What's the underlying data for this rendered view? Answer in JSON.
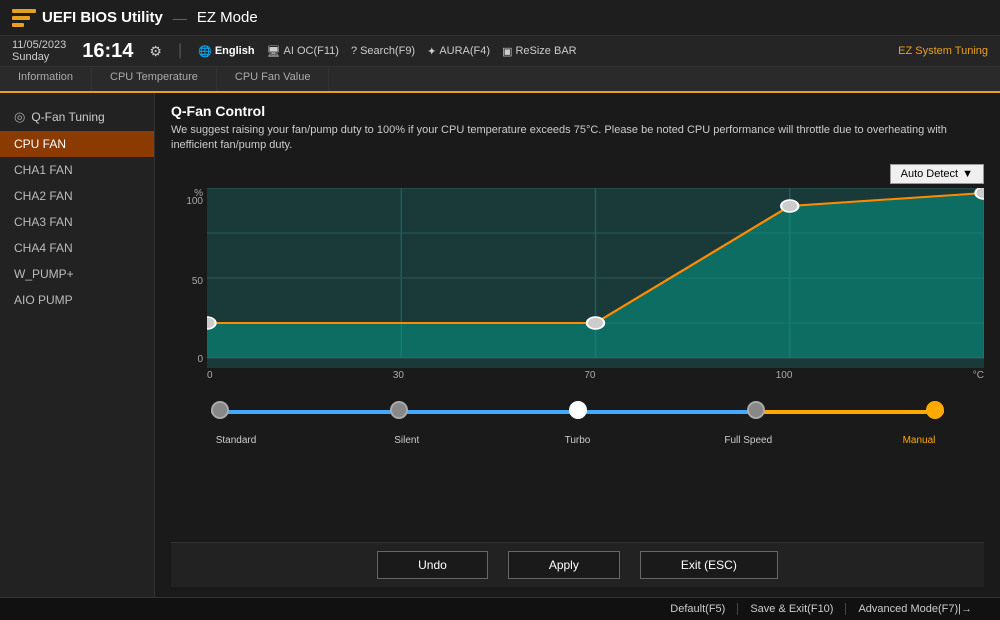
{
  "header": {
    "logo_alt": "ASUS ROG logo",
    "title": "UEFI BIOS Utility",
    "separator": "—",
    "mode": "EZ Mode"
  },
  "subheader": {
    "date": "11/05/2023",
    "day": "Sunday",
    "time": "16:14",
    "gear_icon": "⚙",
    "nav_items": [
      {
        "icon": "🌐",
        "label": "English",
        "key": "F10"
      },
      {
        "icon": "🖥",
        "label": "AI OC(F11)",
        "key": "F11"
      },
      {
        "icon": "?",
        "label": "Search(F9)",
        "key": "F9"
      },
      {
        "icon": "✦",
        "label": "AURA(F4)",
        "key": "F4"
      },
      {
        "icon": "▣",
        "label": "ReSize BAR",
        "key": ""
      }
    ],
    "ez_tuning": "EZ System Tuning"
  },
  "tabs": [
    {
      "label": "Information",
      "active": false
    },
    {
      "label": "CPU Temperature",
      "active": false
    },
    {
      "label": "CPU Fan Value",
      "active": false
    }
  ],
  "sidebar": {
    "section_title": "Q-Fan Tuning",
    "fan_icon": "◎",
    "items": [
      {
        "label": "CPU FAN",
        "active": true
      },
      {
        "label": "CHA1 FAN",
        "active": false
      },
      {
        "label": "CHA2 FAN",
        "active": false
      },
      {
        "label": "CHA3 FAN",
        "active": false
      },
      {
        "label": "CHA4 FAN",
        "active": false
      },
      {
        "label": "W_PUMP+",
        "active": false
      },
      {
        "label": "AIO PUMP",
        "active": false
      }
    ]
  },
  "panel": {
    "title": "Q-Fan Control",
    "description": "We suggest raising your fan/pump duty to 100% if your CPU temperature exceeds 75°C. Please be noted CPU performance will throttle due to overheating with inefficient fan/pump duty.",
    "auto_detect_label": "Auto Detect",
    "dropdown_arrow": "▼"
  },
  "chart": {
    "y_unit": "%",
    "y_labels": [
      "100",
      "50",
      "0"
    ],
    "x_labels": [
      "0",
      "30",
      "70",
      "100"
    ],
    "x_unit": "°C"
  },
  "presets": {
    "items": [
      {
        "label": "Standard",
        "active": false
      },
      {
        "label": "Silent",
        "active": false
      },
      {
        "label": "Turbo",
        "active": true
      },
      {
        "label": "Full Speed",
        "active": false
      },
      {
        "label": "Manual",
        "active": false,
        "is_manual": true
      }
    ]
  },
  "buttons": {
    "undo": "Undo",
    "apply": "Apply",
    "exit": "Exit (ESC)"
  },
  "footer": {
    "items": [
      {
        "label": "Default(F5)"
      },
      {
        "label": "Save & Exit(F10)"
      },
      {
        "label": "Advanced Mode(F7)|→"
      }
    ]
  }
}
